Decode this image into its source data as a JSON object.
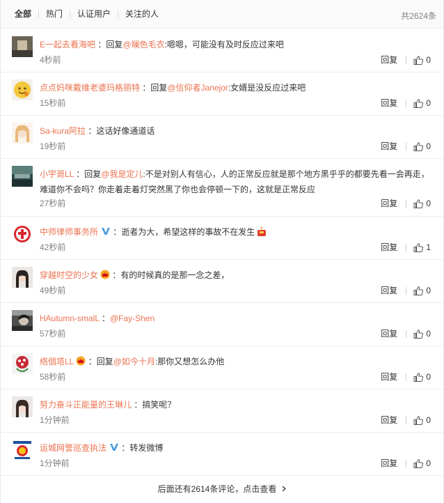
{
  "tabs": [
    "全部",
    "热门",
    "认证用户",
    "关注的人"
  ],
  "total": "共2624条",
  "reply_label": "回复",
  "comments": [
    {
      "user": "E一起去看海吧",
      "reply_prefix": "回复",
      "mention": "@斓色毛衣",
      "text": ":嗯嗯，可能没有及时反应过来吧",
      "time": "4秒前",
      "likes": "0"
    },
    {
      "user": "点点妈咪戴维老婆玛格丽特",
      "reply_prefix": "回复",
      "mention": "@信仰者Janejor",
      "text": ":女婿是没反应过来吧",
      "time": "15秒前",
      "likes": "0"
    },
    {
      "user": "Sa-kura阿拉",
      "text": "这话好像通道话",
      "time": "19秒前",
      "likes": "0"
    },
    {
      "user": "小宇哥LL",
      "reply_prefix": "回复",
      "mention": "@我是定儿",
      "text": ":不是对别人有信心，人的正常反应就是那个地方黑乎乎的都要先看一会再走，难道你不会吗？你走着走着灯突然黑了你也会停顿一下的，这就是正常反应",
      "time": "27秒前",
      "likes": "0"
    },
    {
      "user": "中师律师事务所",
      "text": "逝者为大，希望这样的事故不在发生",
      "time": "42秒前",
      "likes": "1"
    },
    {
      "user": "穿越时空的少女",
      "text": "有的时候真的是那一念之差，",
      "time": "49秒前",
      "likes": "0"
    },
    {
      "user": "HAutumn-smalL",
      "mention": "@Fay-Shen",
      "text": "",
      "time": "57秒前",
      "likes": "0"
    },
    {
      "user": "络個塔LL",
      "reply_prefix": "回复",
      "mention": "@如今十月",
      "text": ":那你又想怎么办他",
      "time": "58秒前",
      "likes": "0"
    },
    {
      "user": "努力奋斗正能量的王琳儿",
      "text": "搞笑呢？",
      "time": "1分钟前",
      "likes": "0"
    },
    {
      "user": "运城网警巡查执法",
      "text": "转发微博",
      "time": "1分钟前",
      "likes": "0"
    }
  ],
  "more_text": "后面还有2614条评论，点击查看",
  "colors": {
    "username": "#eb7350",
    "verified": "#4a9ce0",
    "time": "#808080"
  }
}
